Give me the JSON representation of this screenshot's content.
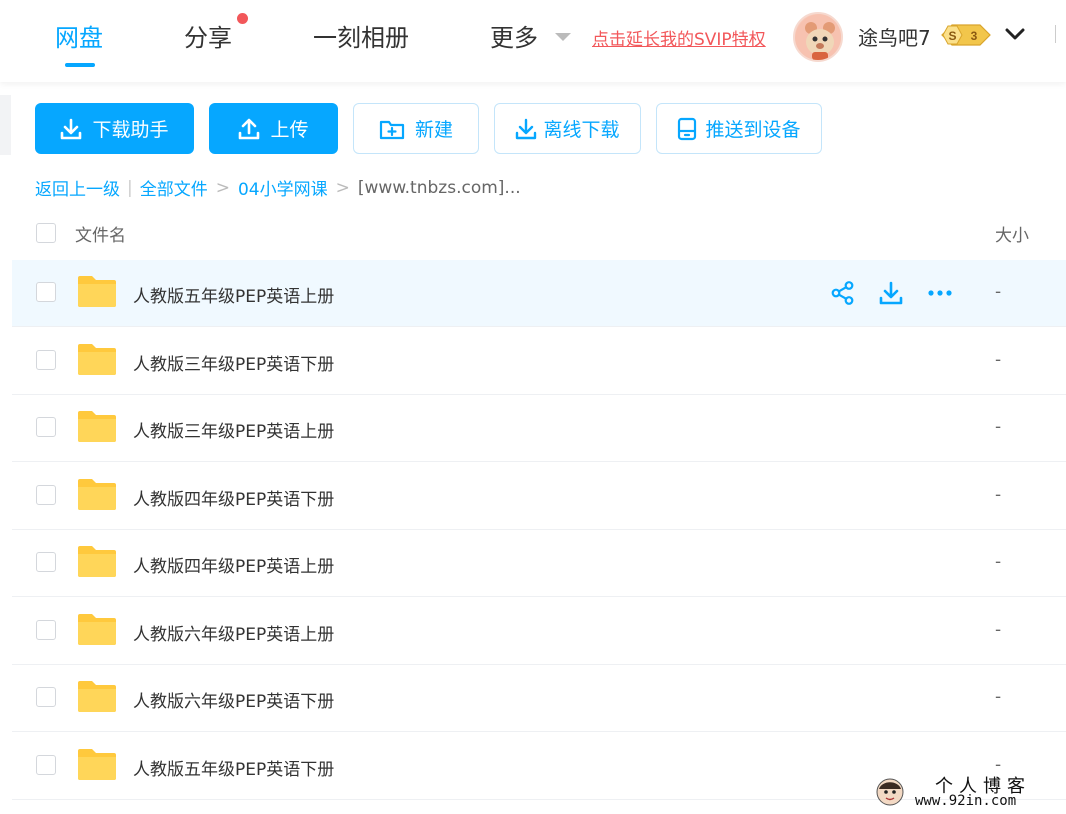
{
  "nav": {
    "tabs": [
      {
        "label": "网盘",
        "active": true
      },
      {
        "label": "分享",
        "active": false,
        "has_dot": true
      },
      {
        "label": "一刻相册",
        "active": false
      },
      {
        "label": "更多",
        "active": false,
        "has_caret": true
      }
    ],
    "svip_link": "点击延长我的SVIP特权",
    "username": "途鸟吧7",
    "vip_level": "3",
    "vip_badge_letter": "S"
  },
  "toolbar": {
    "download_helper": "下载助手",
    "upload": "上传",
    "new": "新建",
    "offline_download": "离线下载",
    "push_device": "推送到设备"
  },
  "breadcrumb": {
    "back": "返回上一级",
    "all_files": "全部文件",
    "folder": "04小学网课",
    "current": "[www.tnbzs.com]..."
  },
  "list": {
    "header_name": "文件名",
    "header_size": "大小",
    "rows": [
      {
        "name": "人教版五年级PEP英语上册",
        "size": "-"
      },
      {
        "name": "人教版三年级PEP英语下册",
        "size": "-"
      },
      {
        "name": "人教版三年级PEP英语上册",
        "size": "-"
      },
      {
        "name": "人教版四年级PEP英语下册",
        "size": "-"
      },
      {
        "name": "人教版四年级PEP英语上册",
        "size": "-"
      },
      {
        "name": "人教版六年级PEP英语上册",
        "size": "-"
      },
      {
        "name": "人教版六年级PEP英语下册",
        "size": "-"
      },
      {
        "name": "人教版五年级PEP英语下册",
        "size": "-"
      }
    ]
  },
  "watermark": {
    "line1": "个人博客",
    "line2": "www.92in.com"
  },
  "colors": {
    "accent": "#06a7ff",
    "svip_red": "#f2575a",
    "folder_yellow": "#ffd659"
  }
}
